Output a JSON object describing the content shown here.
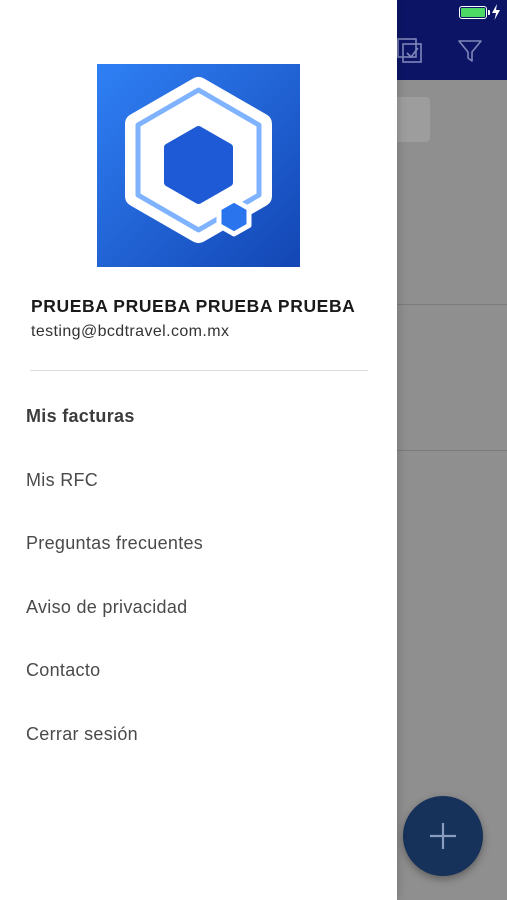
{
  "status_bar": {
    "battery_level": 1.0,
    "charging": true,
    "battery_color": "#4cd964"
  },
  "header": {
    "background": "#0c1466",
    "icons": [
      "select-all-icon",
      "filter-icon"
    ]
  },
  "fab": {
    "icon": "plus-icon",
    "color": "#16315a"
  },
  "drawer": {
    "logo": {
      "icon": "app-logo-hexagon",
      "gradient": [
        "#2f80f5",
        "#1346b4"
      ]
    },
    "user": {
      "name": "PRUEBA PRUEBA PRUEBA PRUEBA",
      "email": "testing@bcdtravel.com.mx"
    },
    "menu": [
      {
        "label": "Mis facturas",
        "active": true
      },
      {
        "label": "Mis RFC",
        "active": false
      },
      {
        "label": "Preguntas frecuentes",
        "active": false
      },
      {
        "label": "Aviso de privacidad",
        "active": false
      },
      {
        "label": "Contacto",
        "active": false
      },
      {
        "label": "Cerrar sesión",
        "active": false
      }
    ]
  }
}
